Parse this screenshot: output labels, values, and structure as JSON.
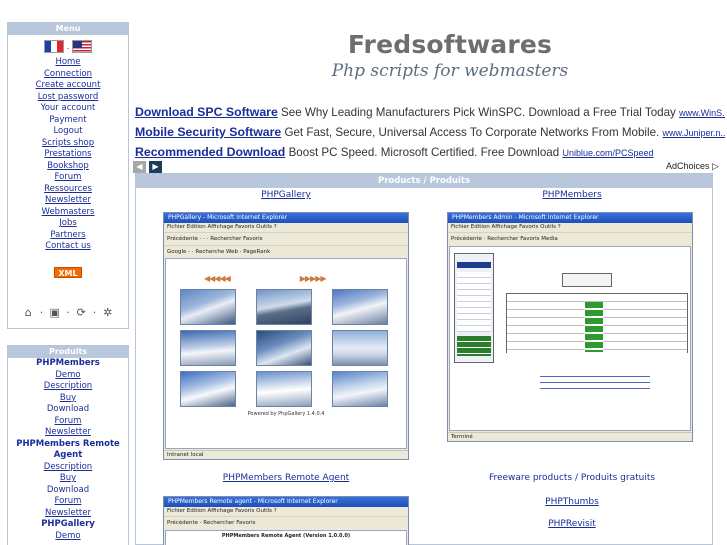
{
  "menu": {
    "title": "Menu",
    "items": [
      "Home",
      "Connection",
      "Create account",
      "Lost password"
    ],
    "plain_items": [
      "Your account",
      "Payment",
      "Logout"
    ],
    "items2": [
      "Scripts shop",
      "Prestations",
      "Bookshop",
      "Forum",
      "Ressources",
      "Newsletter",
      "Webmasters",
      "Jobs",
      "Partners",
      "Contact us"
    ],
    "xml_badge": "XML",
    "flag_separator": "."
  },
  "produits": {
    "title": "Produits",
    "items": [
      {
        "label": "PHPMembers",
        "style": "bold"
      },
      {
        "label": "Demo",
        "style": "link"
      },
      {
        "label": "Description",
        "style": "link"
      },
      {
        "label": "Buy",
        "style": "link"
      },
      {
        "label": "Download",
        "style": "plain"
      },
      {
        "label": "Forum",
        "style": "link"
      },
      {
        "label": "Newsletter",
        "style": "link"
      },
      {
        "label": "PHPMembers Remote",
        "style": "bold"
      },
      {
        "label": "Agent",
        "style": "bold"
      },
      {
        "label": "Description",
        "style": "link"
      },
      {
        "label": "Buy",
        "style": "link"
      },
      {
        "label": "Download",
        "style": "plain"
      },
      {
        "label": "Forum",
        "style": "link"
      },
      {
        "label": "Newsletter",
        "style": "link"
      },
      {
        "label": "PHPGallery",
        "style": "bold"
      },
      {
        "label": "Demo",
        "style": "link"
      }
    ]
  },
  "header": {
    "title": "Fredsoftwares",
    "subtitle": "Php scripts for webmasters"
  },
  "ads": [
    {
      "link": "Download SPC Software",
      "text": "See Why Leading Manufacturers Pick WinSPC. Download a Free Trial Today",
      "url": "www.WinS..."
    },
    {
      "link": "Mobile Security Software",
      "text": "Get Fast, Secure, Universal Access To Corporate Networks From Mobile.",
      "url": "www.Juniper.n..."
    },
    {
      "link": "Recommended Download",
      "text": "Boost PC Speed. Microsoft Certified. Free Download",
      "url": "Uniblue.com/PCSpeed"
    }
  ],
  "adchoices": "AdChoices",
  "products_panel": {
    "title": "Products / Produits",
    "phpgallery": "PHPGallery",
    "phpmembers": "PHPMembers",
    "remote_agent": "PHPMembers Remote Agent",
    "freeware": "Freeware products / Produits gratuits",
    "phpthumbs": "PHPThumbs",
    "phprevisit": "PHPRevisit"
  },
  "gallery_window": {
    "title": "PHPGallery - Microsoft Internet Explorer",
    "menubar": "Fichier   Edition   Affichage   Favoris   Outils   ?",
    "toolbar": "Précédente  ·  ·  ·  Rechercher  Favoris",
    "toolbar2": "Google -  ·  Recherche Web  ·  PageRank",
    "powered": "Powered by PhpGallery 1.4.0.4",
    "status": "Intranet local"
  },
  "members_window": {
    "title": "PHPMembers Admin - Microsoft Internet Explorer",
    "menubar": "Fichier  Edition  Affichage  Favoris  Outils  ?",
    "toolbar": "Précédente  ·  Rechercher  Favoris  Media",
    "status": "Terminé"
  },
  "remote_window": {
    "title": "PHPMembers Remote agent - Microsoft Internet Explorer",
    "menubar": "Fichier  Edition  Affichage  Favoris  Outils  ?",
    "toolbar": "Précédente  ·  Rechercher  Favoris",
    "heading": "PHPMembers Remote Agent (Version 1.0.0.0)"
  },
  "colors": {
    "panel_header_bg": "#b9c7dc",
    "link": "#1a2e9a",
    "logo_gray": "#6e6e6e"
  }
}
